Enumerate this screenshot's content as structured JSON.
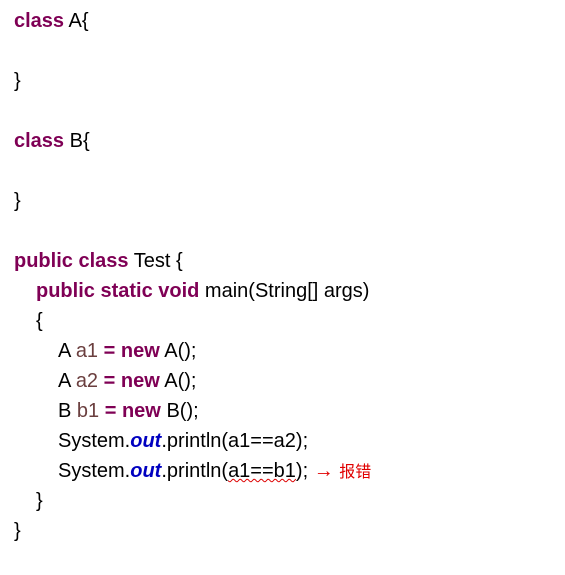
{
  "code": {
    "classA": {
      "decl": "class",
      "name": "A",
      "open": "{",
      "close": "}"
    },
    "classB": {
      "decl": "class",
      "name": "B",
      "open": "{",
      "close": "}"
    },
    "classTest": {
      "mod": "public class",
      "name": "Test",
      "open": "{",
      "main": {
        "sig_mod": "public static void",
        "sig_name": "main",
        "sig_params": "(String[] args)",
        "open": "{",
        "l1": {
          "type": "A",
          "var": "a1",
          "eq": "=",
          "nw": "new",
          "ctor": "A();"
        },
        "l2": {
          "type": "A",
          "var": "a2",
          "eq": "=",
          "nw": "new",
          "ctor": "A();"
        },
        "l3": {
          "type": "B",
          "var": "b1",
          "eq": "=",
          "nw": "new",
          "ctor": "B();"
        },
        "p1": {
          "sys": "System.",
          "out": "out",
          "dot": ".",
          "fn": "println",
          "args": "(a1==a2);"
        },
        "p2": {
          "sys": "System.",
          "out": "out",
          "dot": ".",
          "fn": "println",
          "args_open": "(",
          "args_err": "a1==b1",
          "args_close": ");"
        },
        "close": "}"
      },
      "close": "}"
    },
    "annotation": {
      "arrow": "→",
      "text": "报错"
    }
  }
}
